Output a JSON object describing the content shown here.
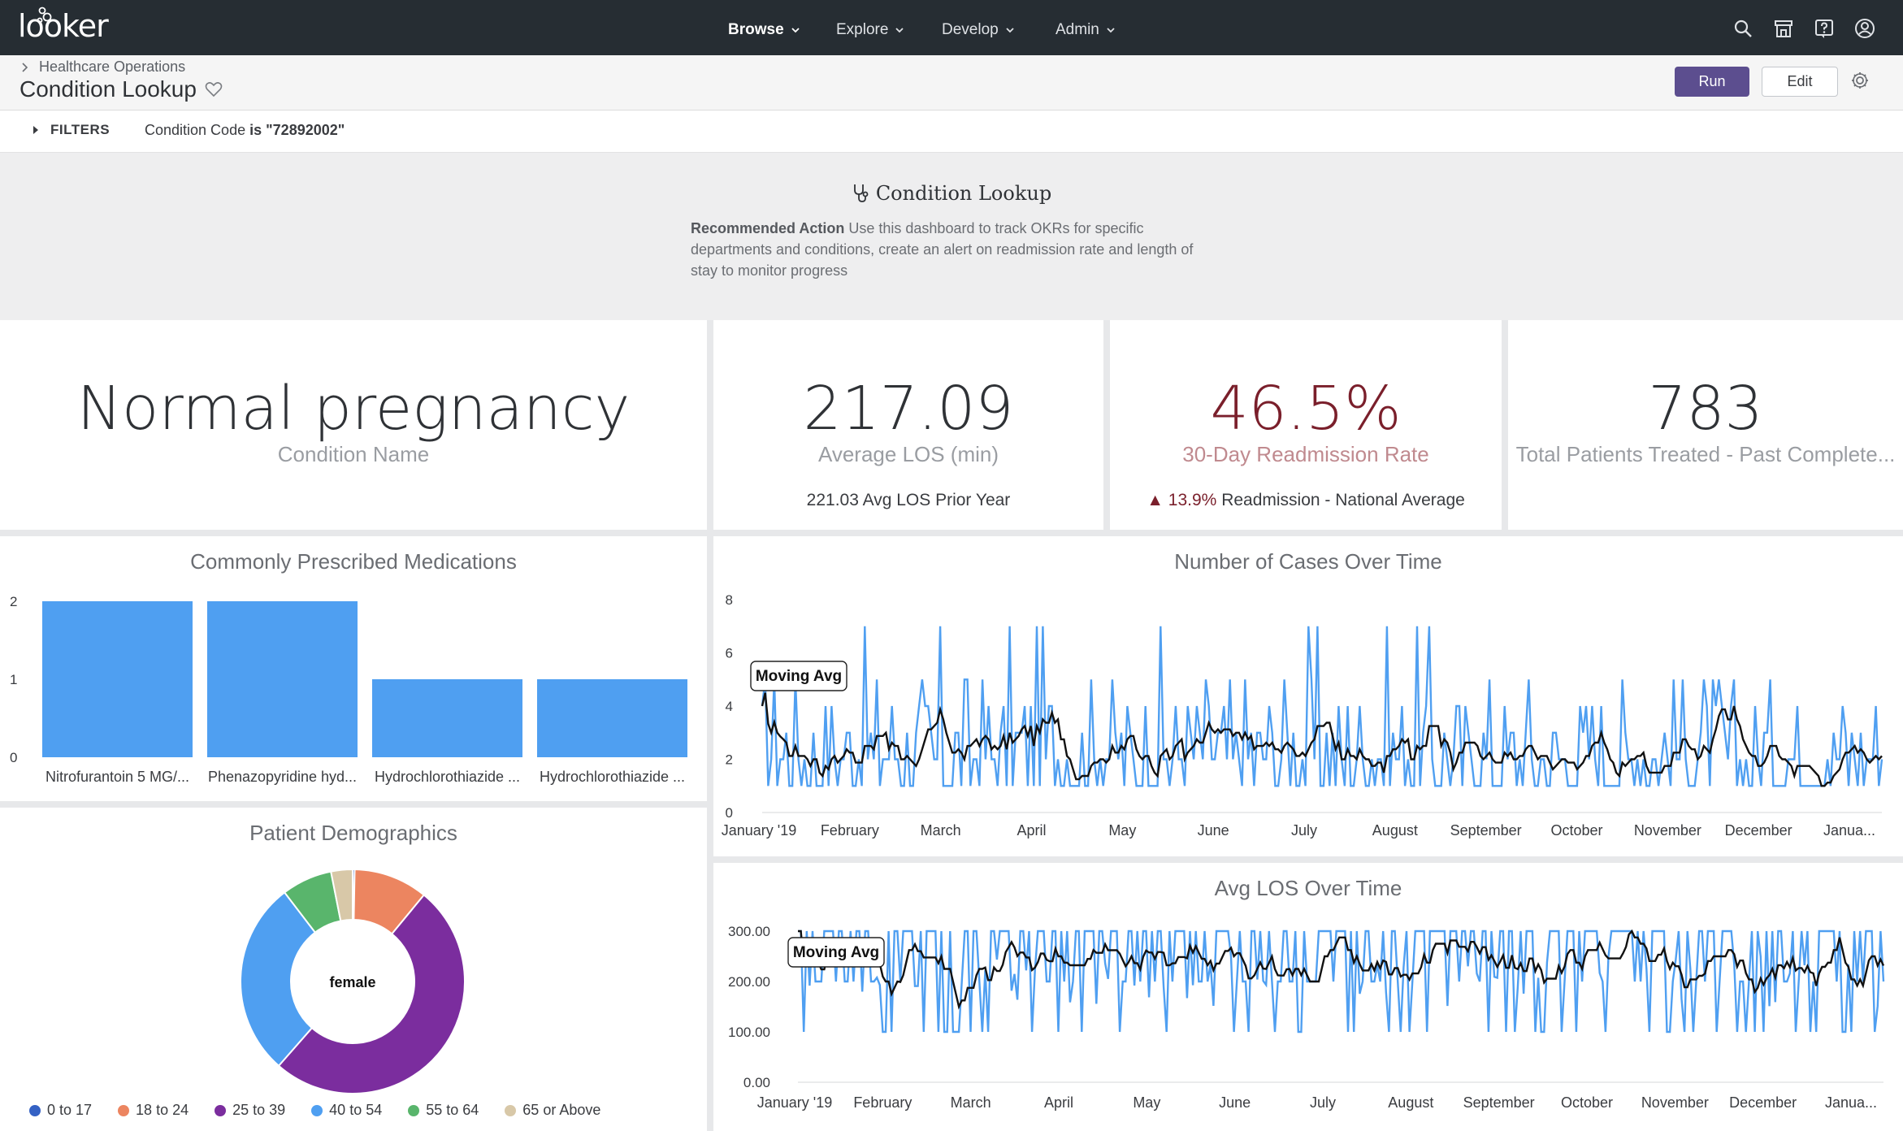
{
  "nav": {
    "logo": "looker",
    "menu": [
      {
        "label": "Browse",
        "active": true
      },
      {
        "label": "Explore",
        "active": false
      },
      {
        "label": "Develop",
        "active": false
      },
      {
        "label": "Admin",
        "active": false
      }
    ],
    "icons": [
      "search-icon",
      "marketplace-icon",
      "help-icon",
      "user-icon"
    ]
  },
  "header": {
    "breadcrumb": "Healthcare Operations",
    "title": "Condition Lookup",
    "run_label": "Run",
    "edit_label": "Edit"
  },
  "filters": {
    "label": "FILTERS",
    "field": "Condition Code",
    "operator": "is",
    "value": "\"72892002\""
  },
  "text_tile": {
    "title": "Condition Lookup",
    "lead": "Recommended Action",
    "body": " Use this dashboard to track OKRs for specific departments and conditions, create an alert on readmission rate and length of stay to monitor progress"
  },
  "kpis": {
    "condition": {
      "value": "Normal pregnancy",
      "label": "Condition Name"
    },
    "los": {
      "value": "217.09",
      "label": "Average LOS (min)",
      "compare_value": "221.03",
      "compare_label": " Avg LOS Prior Year"
    },
    "readmission": {
      "value": "46.5%",
      "label": "30-Day Readmission Rate",
      "compare_value": "▲ 13.9%",
      "compare_label": " Readmission - National Average",
      "color": "#7a1f2b",
      "label_color": "#c08a8f"
    },
    "patients": {
      "value": "783",
      "label": "Total Patients Treated - Past Complete..."
    }
  },
  "medications": {
    "title": "Commonly Prescribed Medications",
    "chart_data": {
      "type": "bar",
      "categories": [
        "Nitrofurantoin 5 MG/...",
        "Phenazopyridine hyd...",
        "Hydrochlorothiazide ...",
        "Hydrochlorothiazide ..."
      ],
      "values": [
        2,
        2,
        1,
        1
      ],
      "ylim": [
        0,
        2
      ],
      "yticks": [
        "2",
        "1",
        "0"
      ],
      "color": "#4f9ff1"
    }
  },
  "cases": {
    "title": "Number of Cases Over Time",
    "annotation": "Moving Avg",
    "chart_data": {
      "type": "line",
      "ylim": [
        0,
        8
      ],
      "yticks": [
        "8",
        "6",
        "4",
        "2",
        "0"
      ],
      "xticks": [
        "January '19",
        "February",
        "March",
        "April",
        "May",
        "June",
        "July",
        "August",
        "September",
        "October",
        "November",
        "December",
        "Janua..."
      ],
      "series": [
        {
          "color": "#4f9ff1"
        },
        {
          "name": "Moving Avg",
          "color": "#111111"
        }
      ]
    }
  },
  "avglos": {
    "title": "Avg LOS Over Time",
    "annotation": "Moving Avg",
    "chart_data": {
      "type": "line",
      "ylim": [
        0,
        300
      ],
      "yticks": [
        "300.00",
        "200.00",
        "100.00",
        "0.00"
      ],
      "xticks": [
        "January '19",
        "February",
        "March",
        "April",
        "May",
        "June",
        "July",
        "August",
        "September",
        "October",
        "November",
        "December",
        "Janua..."
      ],
      "series": [
        {
          "color": "#4f9ff1"
        },
        {
          "name": "Moving Avg",
          "color": "#111111"
        }
      ]
    }
  },
  "demographics": {
    "title": "Patient Demographics",
    "center_label": "female",
    "chart_data": {
      "type": "pie",
      "categories": [
        "0 to 17",
        "18 to 24",
        "25 to 39",
        "40 to 54",
        "55 to 64",
        "65 or Above"
      ],
      "values": [
        0.3,
        11,
        52,
        29,
        7.5,
        3.2
      ],
      "colors": [
        "#3461c4",
        "#ec8560",
        "#7b2d9e",
        "#4f9ff1",
        "#59b56c",
        "#d8c8a8"
      ]
    }
  }
}
